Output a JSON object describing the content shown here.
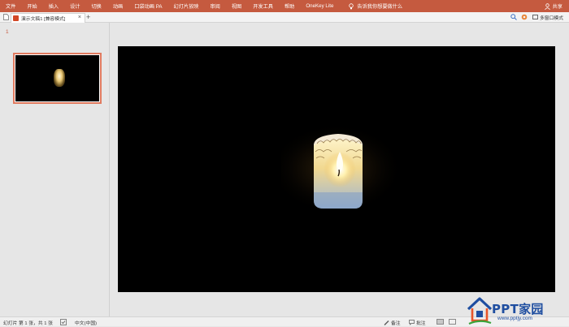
{
  "ribbon": {
    "menu": [
      "文件",
      "开始",
      "插入",
      "设计",
      "切换",
      "动画",
      "口袋动画 PA",
      "幻灯片放映",
      "审阅",
      "视图",
      "开发工具",
      "帮助",
      "OneKey Lite"
    ],
    "first_menu": "文件",
    "tell_me": "告诉我你想要做什么",
    "share": "共享",
    "color": "#c55a3f"
  },
  "tabbar": {
    "document_tab": "演示文稿1 [兼容模式]",
    "close": "×",
    "new_tab": "+",
    "multi_window": "多窗口模式"
  },
  "thumbnails": {
    "slide_number": "1",
    "accent": "#e07a5f"
  },
  "statusbar": {
    "slide_info": "幻灯片 第 1 张，共 1 张",
    "language": "中文(中国)",
    "notes": "备注",
    "comments": "批注"
  },
  "logo": {
    "brand": "PPT家园",
    "url": "www.pptjy.com"
  }
}
